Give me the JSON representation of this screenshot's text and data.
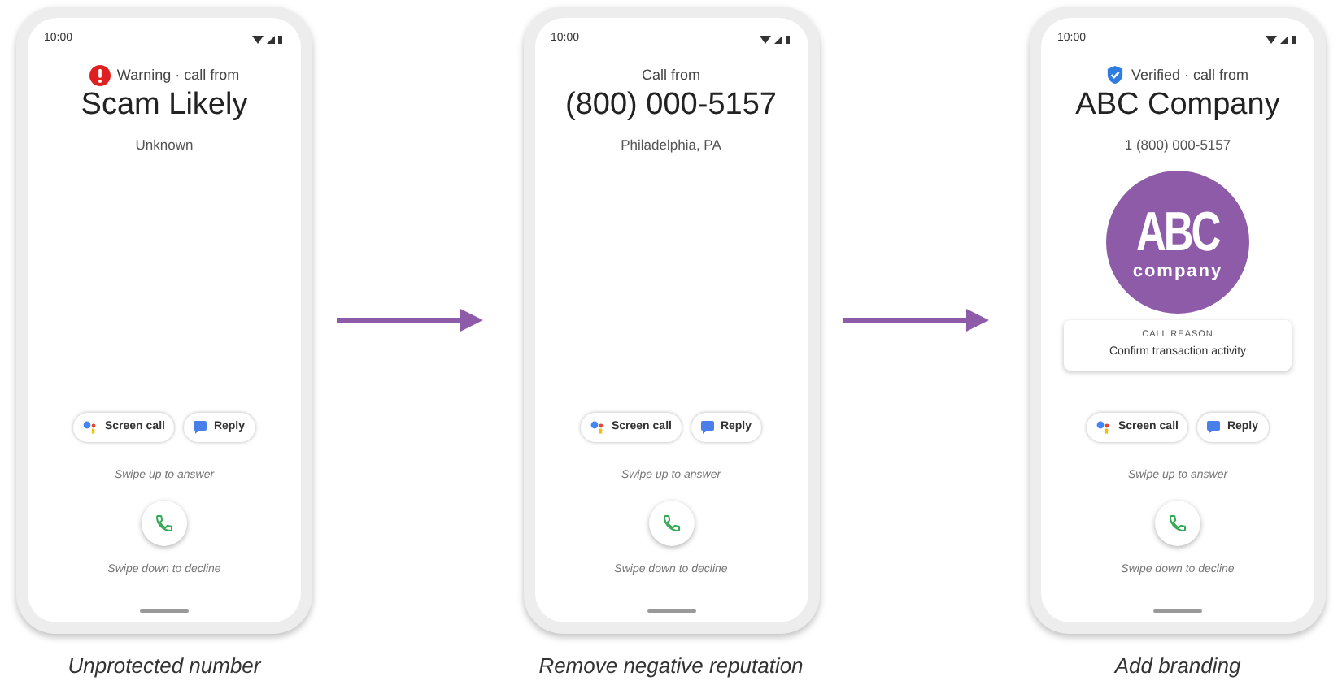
{
  "phones": [
    {
      "time": "10:00",
      "kind": "warning",
      "header": "Warning · call from",
      "title": "Scam Likely",
      "subtitle": "Unknown",
      "actions": [
        "Screen call",
        "Reply"
      ],
      "swipe_up": "Swipe up to answer",
      "swipe_down": "Swipe down to decline",
      "caption": "Unprotected number"
    },
    {
      "time": "10:00",
      "kind": "plain",
      "header": "Call from",
      "title": "(800) 000-5157",
      "subtitle": "Philadelphia, PA",
      "actions": [
        "Screen call",
        "Reply"
      ],
      "swipe_up": "Swipe up to answer",
      "swipe_down": "Swipe down to decline",
      "caption": "Remove negative reputation"
    },
    {
      "time": "10:00",
      "kind": "verified",
      "header": "Verified · call from",
      "title": "ABC Company",
      "subtitle": "1 (800) 000-5157",
      "logo": {
        "big": "ABC",
        "small": "company",
        "color": "#8e5ba8"
      },
      "reason": {
        "label": "CALL REASON",
        "text": "Confirm transaction activity"
      },
      "actions": [
        "Screen call",
        "Reply"
      ],
      "swipe_up": "Swipe up to answer",
      "swipe_down": "Swipe down to decline",
      "caption": "Add branding"
    }
  ]
}
